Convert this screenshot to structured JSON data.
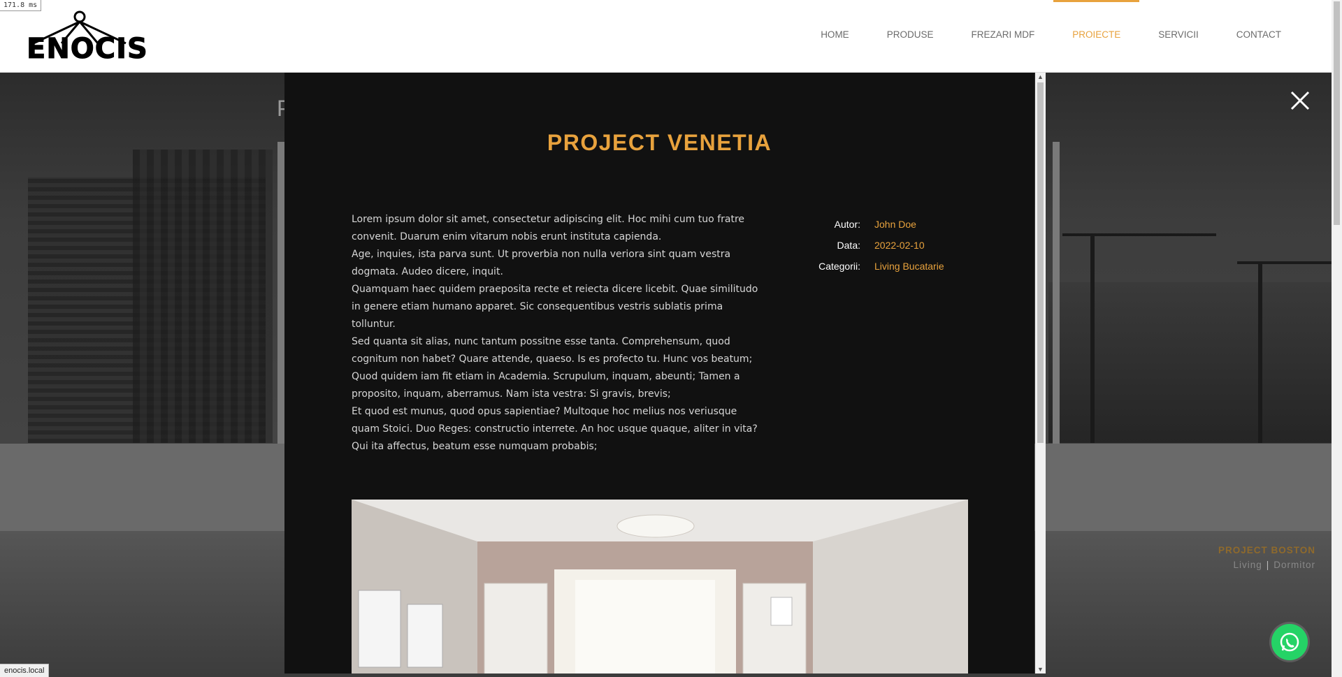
{
  "perf": "171.8 ms",
  "brand": {
    "name": "ENOCIS"
  },
  "nav": {
    "items": [
      {
        "label": "HOME",
        "active": false
      },
      {
        "label": "PRODUSE",
        "active": false
      },
      {
        "label": "FREZARI MDF",
        "active": false
      },
      {
        "label": "PROIECTE",
        "active": true
      },
      {
        "label": "SERVICII",
        "active": false
      },
      {
        "label": "CONTACT",
        "active": false
      }
    ]
  },
  "background": {
    "title_fragment": "P",
    "project_title": "PROJECT BOSTON",
    "project_cat1": "Living",
    "project_cat2": "Dormitor"
  },
  "modal": {
    "title": "PROJECT VENETIA",
    "paragraphs": [
      "Lorem ipsum dolor sit amet, consectetur adipiscing elit. Hoc mihi cum tuo fratre convenit. Duarum enim vitarum nobis erunt instituta capienda.",
      "Age, inquies, ista parva sunt. Ut proverbia non nulla veriora sint quam vestra dogmata. Audeo dicere, inquit.",
      "Quamquam haec quidem praeposita recte et reiecta dicere licebit. Quae similitudo in genere etiam humano apparet. Sic consequentibus vestris sublatis prima tolluntur.",
      "Sed quanta sit alias, nunc tantum possitne esse tanta. Comprehensum, quod cognitum non habet? Quare attende, quaeso. Is es profecto tu. Hunc vos beatum;",
      "Quod quidem iam fit etiam in Academia. Scrupulum, inquam, abeunti; Tamen a proposito, inquam, aberramus. Nam ista vestra: Si gravis, brevis;",
      "Et quod est munus, quod opus sapientiae? Multoque hoc melius nos veriusque quam Stoici. Duo Reges: constructio interrete. An hoc usque quaque, aliter in vita? Qui ita affectus, beatum esse numquam probabis;"
    ],
    "meta": {
      "author_label": "Autor:",
      "author_value": "John Doe",
      "date_label": "Data:",
      "date_value": "2022-02-10",
      "category_label": "Categorii:",
      "category_value": "Living Bucatarie"
    }
  },
  "status_bar": "enocis.local",
  "colors": {
    "accent": "#e8a23d",
    "highlight": "#3dae6a",
    "modal_bg": "#111111"
  }
}
